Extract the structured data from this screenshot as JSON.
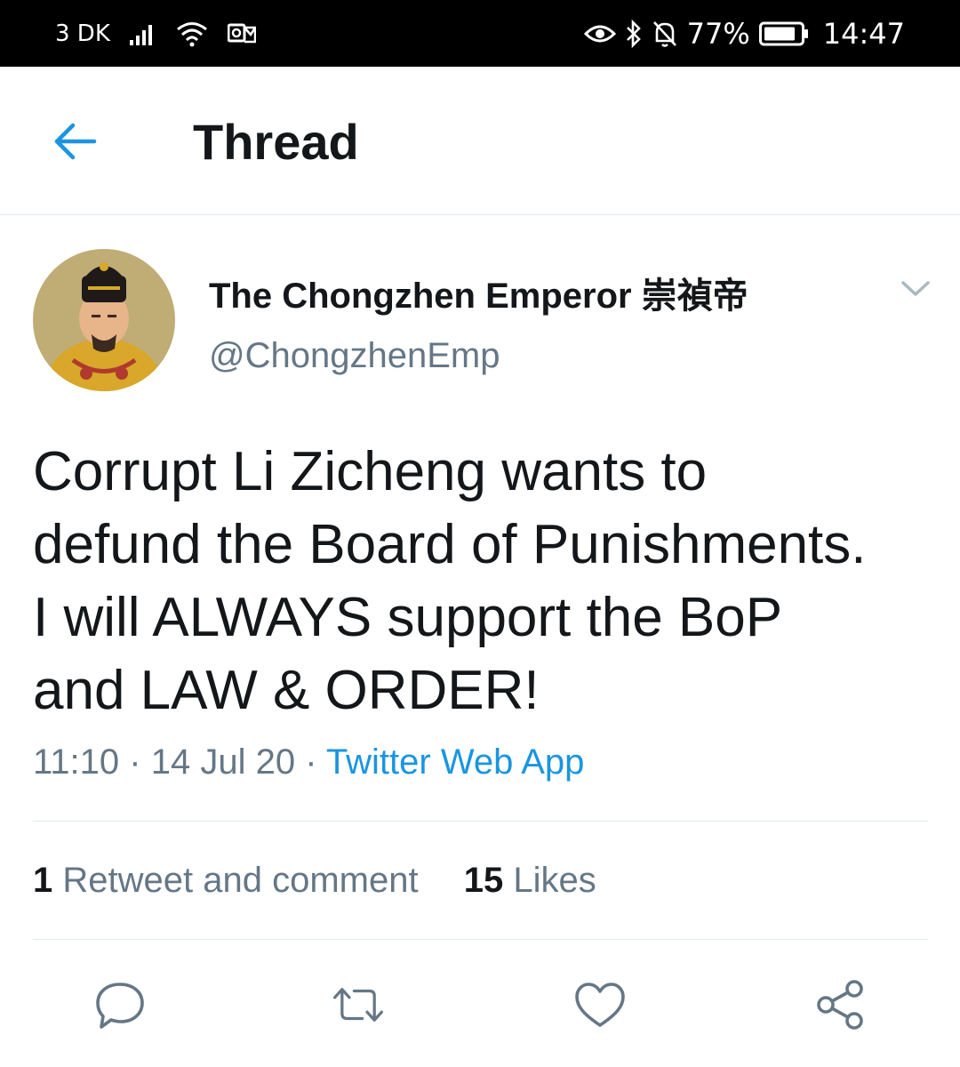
{
  "status_bar": {
    "carrier": "3 DK",
    "battery": "77%",
    "time": "14:47",
    "icons": [
      "signal-icon",
      "wifi-icon",
      "notification-app-icon",
      "eye-icon",
      "bluetooth-icon",
      "bell-off-icon",
      "battery-icon"
    ]
  },
  "header": {
    "title": "Thread",
    "back_icon": "arrow-left-icon"
  },
  "tweet": {
    "author_name": "The Chongzhen Emperor 崇禎帝",
    "handle": "@ChongzhenEmp",
    "lines": [
      "Corrupt Li Zicheng wants to",
      "defund the Board of Punishments.",
      "I will ALWAYS support the BoP",
      "and LAW & ORDER!"
    ],
    "time": "11:10",
    "date": "14 Jul 20",
    "separator": "·",
    "source": "Twitter Web App",
    "retweets_count": "1",
    "retweets_label": "Retweet and comment",
    "likes_count": "15",
    "likes_label": "Likes"
  },
  "colors": {
    "accent": "#1b95e0",
    "secondary_text": "#657786",
    "primary_text": "#14171a",
    "divider": "#e1e8ed"
  },
  "actions": [
    "reply-icon",
    "retweet-icon",
    "like-icon",
    "share-icon"
  ]
}
